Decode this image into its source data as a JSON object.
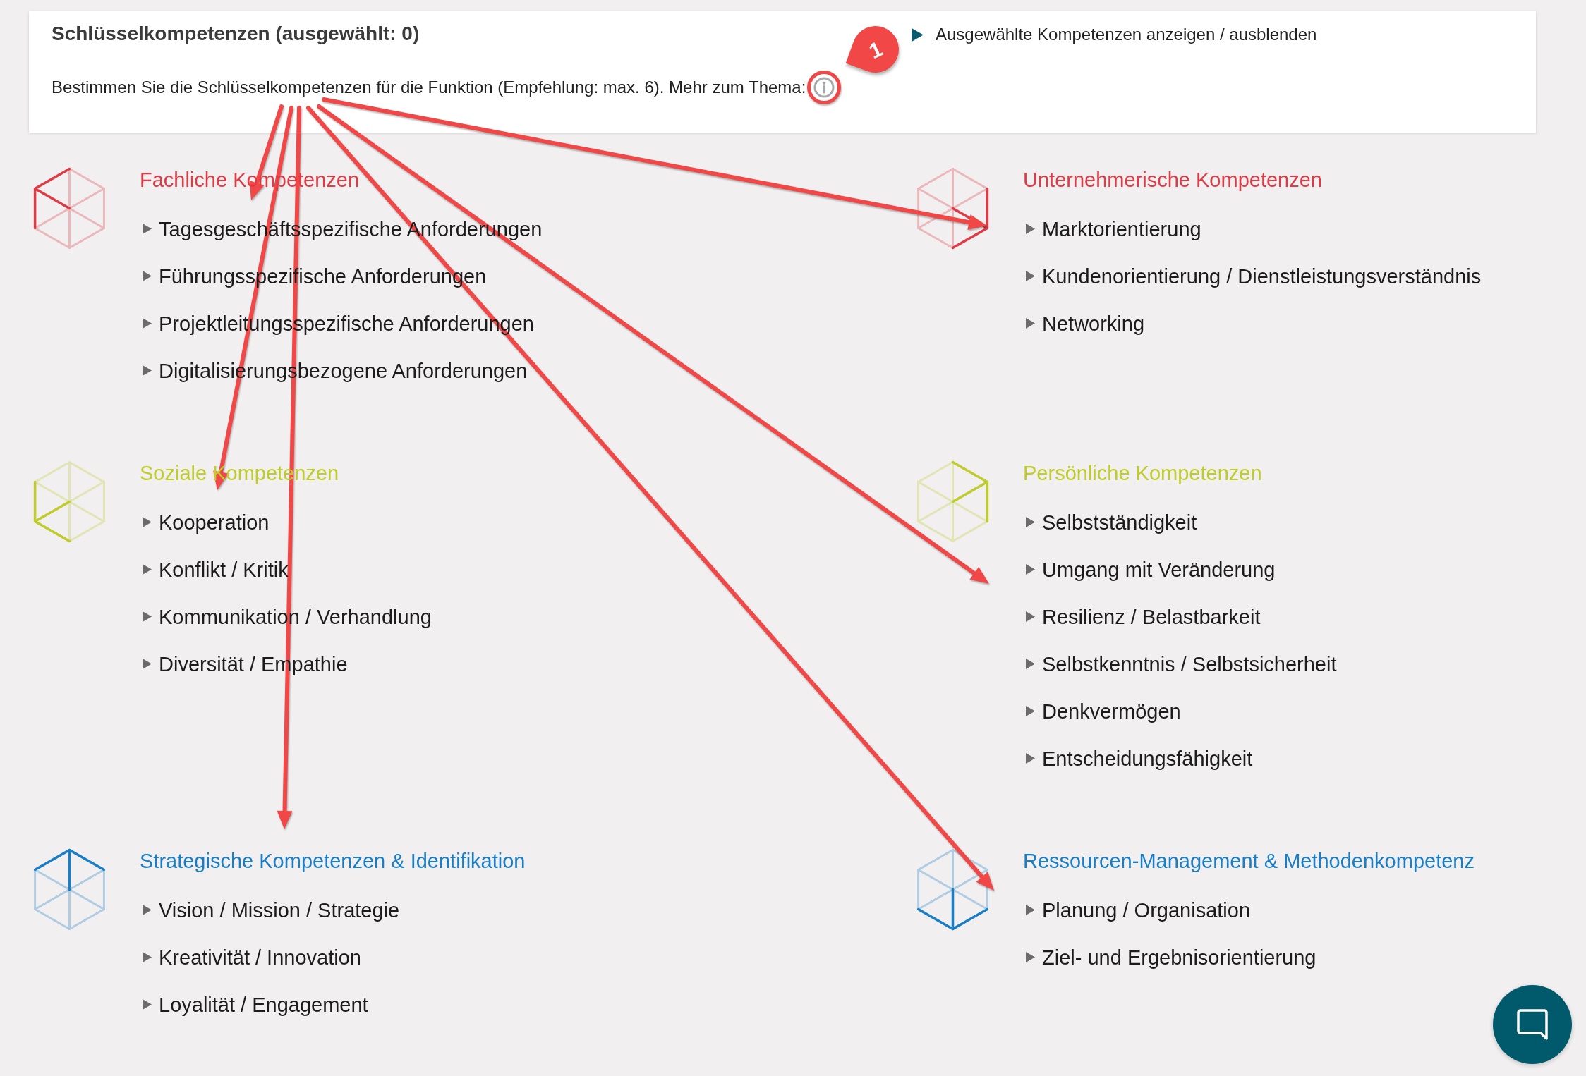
{
  "header": {
    "title": "Schlüsselkompetenzen (ausgewählt: 0)",
    "description": "Bestimmen Sie die Schlüsselkompetenzen für die Funktion (Empfehlung: max. 6). Mehr zum Thema:",
    "toggle": {
      "label": "Ausgewählte Kompetenzen anzeigen / ausblenden",
      "expanded": false
    }
  },
  "sections": [
    {
      "title": "Fachliche Kompetenzen",
      "color": "#e03a45",
      "items": [
        {
          "label": "Tagesgeschäftsspezifische Anforderungen",
          "expanded": false
        },
        {
          "label": "Führungsspezifische Anforderungen",
          "expanded": false
        },
        {
          "label": "Projektleitungsspezifische Anforderungen",
          "expanded": false
        },
        {
          "label": "Digitalisierungsbezogene Anforderungen",
          "expanded": false
        }
      ]
    },
    {
      "title": "Unternehmerische Kompetenzen",
      "color": "#e03a45",
      "items": [
        {
          "label": "Marktorientierung",
          "expanded": false
        },
        {
          "label": "Kundenorientierung / Dienstleistungsverständnis",
          "expanded": false
        },
        {
          "label": "Networking",
          "expanded": false
        }
      ]
    },
    {
      "title": "Soziale Kompetenzen",
      "color": "#bfcc2a",
      "items": [
        {
          "label": "Kooperation",
          "expanded": false
        },
        {
          "label": "Konflikt / Kritik",
          "expanded": false
        },
        {
          "label": "Kommunikation / Verhandlung",
          "expanded": false
        },
        {
          "label": "Diversität / Empathie",
          "expanded": false
        }
      ]
    },
    {
      "title": "Persönliche Kompetenzen",
      "color": "#bfcc2a",
      "items": [
        {
          "label": "Selbstständigkeit",
          "expanded": false
        },
        {
          "label": "Umgang mit Veränderung",
          "expanded": false
        },
        {
          "label": "Resilienz / Belastbarkeit",
          "expanded": false
        },
        {
          "label": "Selbstkenntnis / Selbstsicherheit",
          "expanded": false
        },
        {
          "label": "Denkvermögen",
          "expanded": false
        },
        {
          "label": "Entscheidungsfähigkeit",
          "expanded": false
        }
      ]
    },
    {
      "title": "Strategische Kompetenzen & Identifikation",
      "color": "#1a7ec6",
      "items": [
        {
          "label": "Vision / Mission / Strategie",
          "expanded": false
        },
        {
          "label": "Kreativität / Innovation",
          "expanded": false
        },
        {
          "label": "Loyalität / Engagement",
          "expanded": false
        }
      ]
    },
    {
      "title": "Ressourcen-Management & Methodenkompetenz",
      "color": "#1a7ec6",
      "items": [
        {
          "label": "Planung / Organisation",
          "expanded": false
        },
        {
          "label": "Ziel- und Ergebnisorientierung",
          "expanded": false
        }
      ]
    }
  ],
  "annotation": {
    "callout": "1"
  }
}
